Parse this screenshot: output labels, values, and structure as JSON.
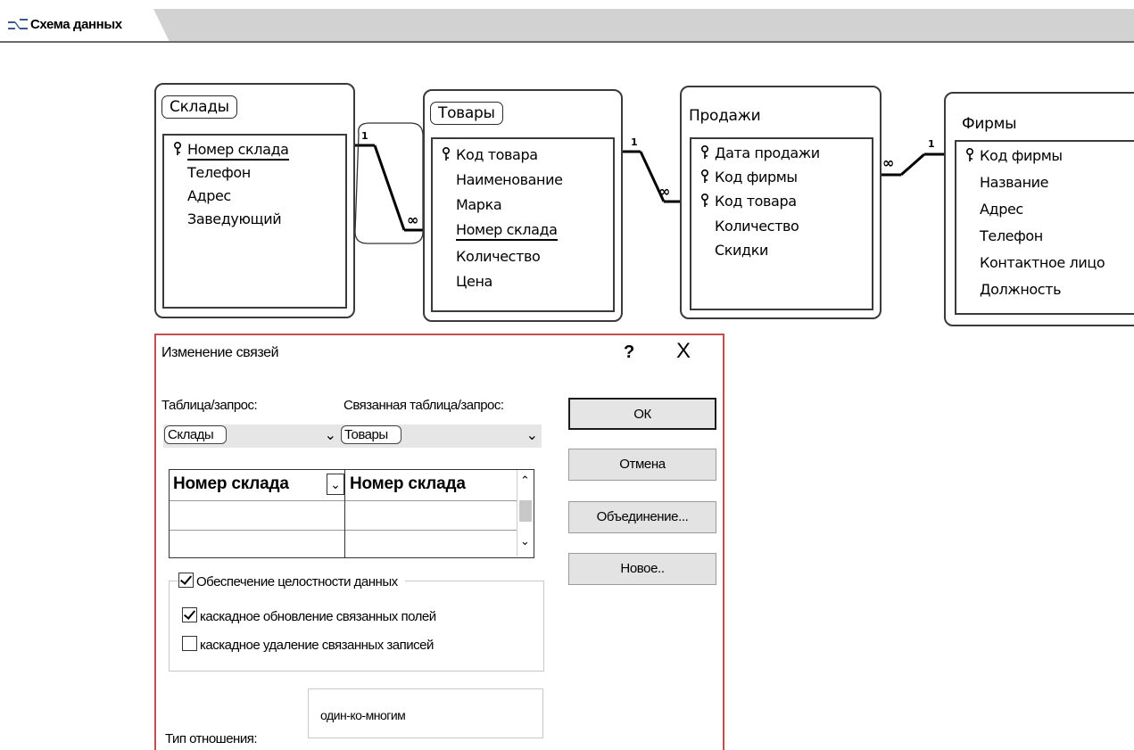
{
  "tab": {
    "label": "Схема данных",
    "icon": "relationships-icon"
  },
  "tables": {
    "sklady": {
      "title": "Склады",
      "fields": [
        "Номер склада",
        "Телефон",
        "Адрес",
        "Заведующий"
      ]
    },
    "tovary": {
      "title": "Товары",
      "fields": [
        "Код товара",
        "Наименование",
        "Марка",
        "Номер склада",
        "Количество",
        "Цена"
      ]
    },
    "prodazhi": {
      "title": "Продажи",
      "fields": [
        "Дата продажи",
        "Код фирмы",
        "Код товара",
        "Количество",
        "Скидки"
      ]
    },
    "firmy": {
      "title": "Фирмы",
      "fields": [
        "Код фирмы",
        "Название",
        "Адрес",
        "Телефон",
        "Контактное лицо",
        "Должность"
      ]
    }
  },
  "relations": {
    "one": "1",
    "many": "∞"
  },
  "dialog": {
    "title": "Изменение связей",
    "help": "?",
    "close": "X",
    "table_label": "Таблица/запрос:",
    "related_label": "Связанная таблица/запрос:",
    "table_value": "Склады",
    "related_value": "Товары",
    "grid": {
      "left": "Номер склада",
      "right": "Номер склада"
    },
    "buttons": {
      "ok": "ОК",
      "cancel": "Отмена",
      "join": "Объединение...",
      "new": "Новое.."
    },
    "checks": {
      "integrity": {
        "label": "Обеспечение целостности данных",
        "checked": true
      },
      "cascade_update": {
        "label": "каскадное обновление связанных полей",
        "checked": true
      },
      "cascade_delete": {
        "label": "каскадное удаление связанных записей",
        "checked": false
      }
    },
    "reltype_label": "Тип отношения:",
    "reltype_value": "один-ко-многим"
  },
  "colors": {
    "dialog_border": "#c0504d",
    "tabstrip": "#d2d2d2"
  }
}
